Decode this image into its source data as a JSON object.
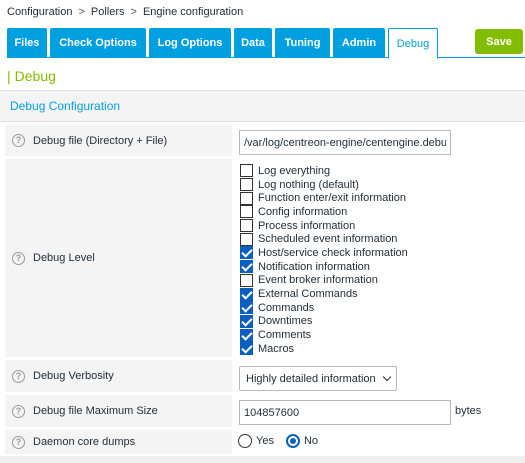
{
  "breadcrumb": {
    "items": [
      "Configuration",
      "Pollers",
      "Engine configuration"
    ],
    "sep": ">"
  },
  "tabs": [
    {
      "label": "Files"
    },
    {
      "label": "Check Options"
    },
    {
      "label": "Log Options"
    },
    {
      "label": "Data"
    },
    {
      "label": "Tuning"
    },
    {
      "label": "Admin"
    },
    {
      "label": "Debug"
    }
  ],
  "save_label": "Save",
  "heading": {
    "bar": "|",
    "title": "Debug"
  },
  "section_title": "Debug Configuration",
  "help_glyph": "?",
  "fields": {
    "debug_file": {
      "label": "Debug file (Directory + File)",
      "value": "/var/log/centreon-engine/centengine.debug"
    },
    "debug_level": {
      "label": "Debug Level",
      "options": [
        {
          "label": "Log everything",
          "checked": false
        },
        {
          "label": "Log nothing (default)",
          "checked": false
        },
        {
          "label": "Function enter/exit information",
          "checked": false
        },
        {
          "label": "Config information",
          "checked": false
        },
        {
          "label": "Process information",
          "checked": false
        },
        {
          "label": "Scheduled event information",
          "checked": false
        },
        {
          "label": "Host/service check information",
          "checked": true
        },
        {
          "label": "Notification information",
          "checked": true
        },
        {
          "label": "Event broker information",
          "checked": false
        },
        {
          "label": "External Commands",
          "checked": true
        },
        {
          "label": "Commands",
          "checked": true
        },
        {
          "label": "Downtimes",
          "checked": true
        },
        {
          "label": "Comments",
          "checked": true
        },
        {
          "label": "Macros",
          "checked": true
        }
      ]
    },
    "debug_verbosity": {
      "label": "Debug Verbosity",
      "value": "Highly detailed information"
    },
    "debug_max_size": {
      "label": "Debug file Maximum Size",
      "value": "104857600",
      "unit": "bytes"
    },
    "core_dumps": {
      "label": "Daemon core dumps",
      "options": [
        {
          "label": "Yes",
          "selected": false
        },
        {
          "label": "No",
          "selected": true
        }
      ]
    }
  }
}
